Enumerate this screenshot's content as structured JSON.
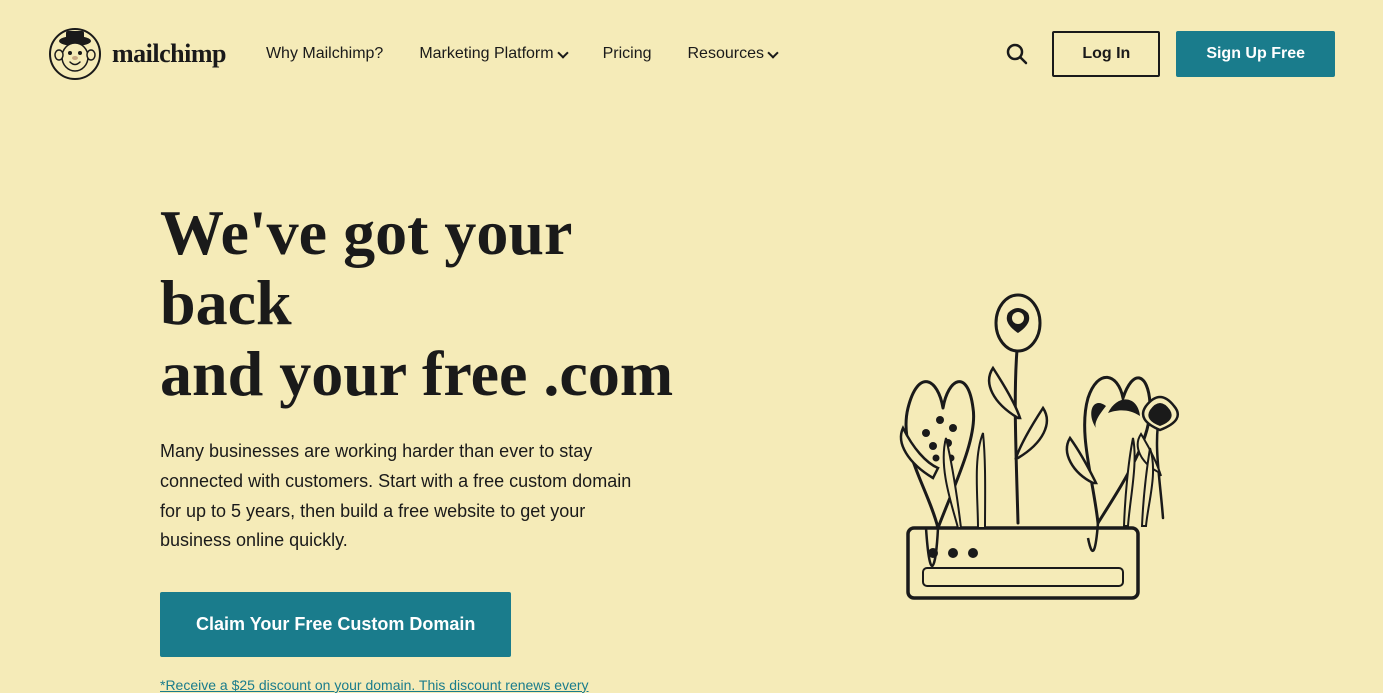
{
  "header": {
    "logo_text": "mailchimp",
    "nav": {
      "items": [
        {
          "label": "Why Mailchimp?",
          "has_dropdown": false
        },
        {
          "label": "Marketing Platform",
          "has_dropdown": true
        },
        {
          "label": "Pricing",
          "has_dropdown": false
        },
        {
          "label": "Resources",
          "has_dropdown": true
        }
      ]
    },
    "login_label": "Log In",
    "signup_label": "Sign Up Free"
  },
  "hero": {
    "title_line1": "We've got your back",
    "title_line2": "and your free .com",
    "description": "Many businesses are working harder than ever to stay connected with customers. Start with a free custom domain for up to 5 years, then build a free website to get your business online quickly.",
    "cta_label": "Claim Your Free Custom Domain",
    "footnote": "*Receive a $25 discount on your domain. This discount renews every"
  },
  "icons": {
    "search": "🔍",
    "chevron_down": "▾"
  }
}
